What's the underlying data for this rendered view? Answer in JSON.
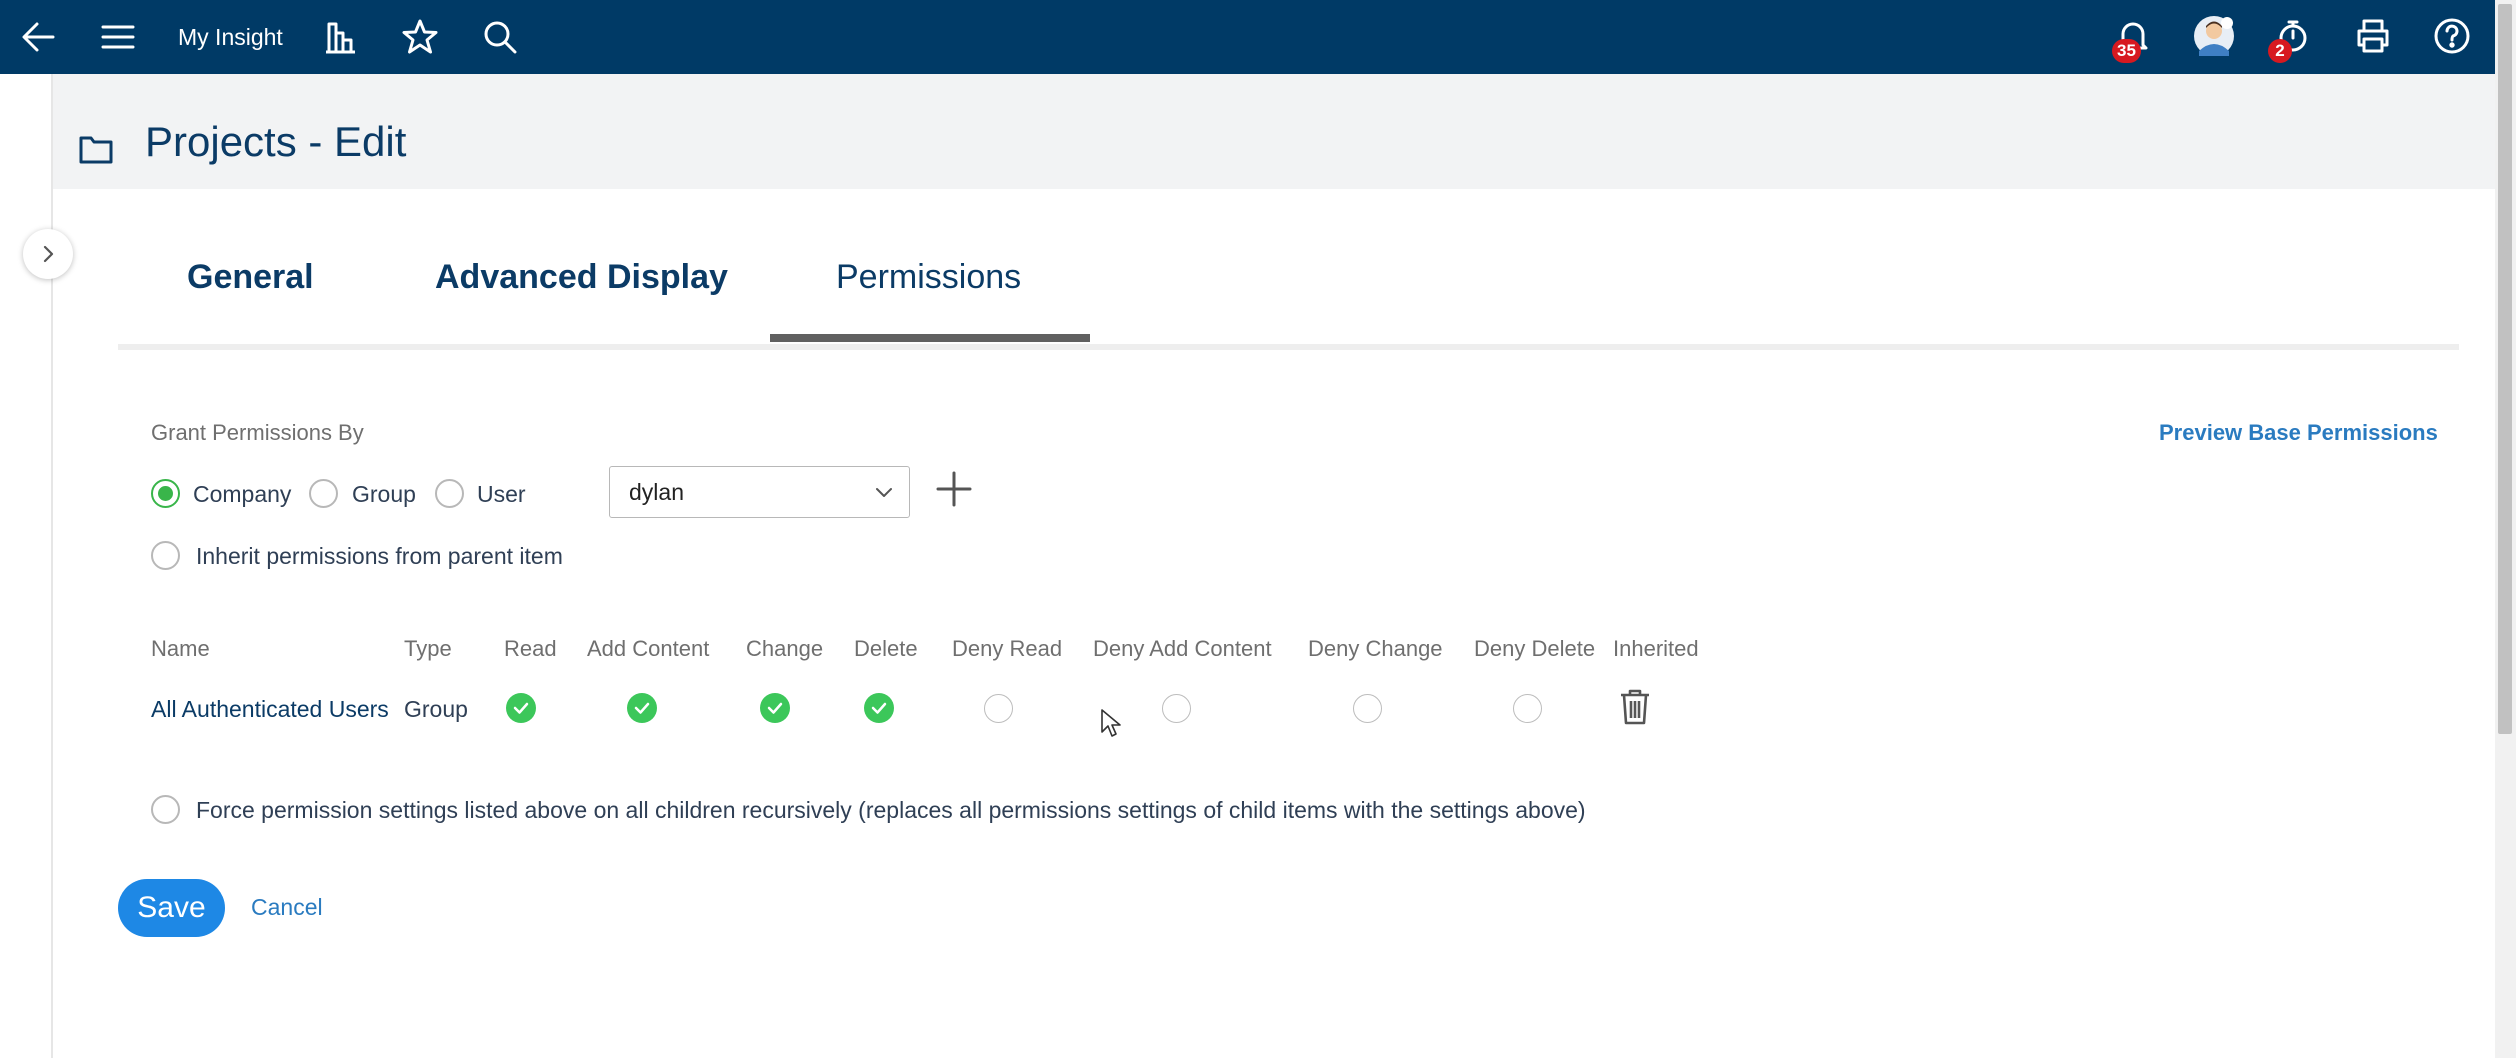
{
  "topbar": {
    "app_title": "My Insight",
    "notifications_count": "35",
    "timers_count": "2",
    "icons": [
      "back-arrow-icon",
      "menu-icon",
      "bar-chart-icon",
      "star-icon",
      "search-icon",
      "bell-icon",
      "user-avatar",
      "stopwatch-icon",
      "printer-icon",
      "help-icon"
    ]
  },
  "page": {
    "title": "Projects - Edit"
  },
  "tabs": [
    {
      "label": "General",
      "active": false
    },
    {
      "label": "Advanced Display",
      "active": false
    },
    {
      "label": "Permissions",
      "active": true
    }
  ],
  "grant": {
    "label": "Grant Permissions By",
    "preview_link": "Preview Base Permissions",
    "options": [
      {
        "label": "Company",
        "selected": true
      },
      {
        "label": "Group",
        "selected": false
      },
      {
        "label": "User",
        "selected": false
      }
    ],
    "dropdown_value": "dylan",
    "inherit_label": "Inherit permissions from parent item"
  },
  "table": {
    "headers": [
      "Name",
      "Type",
      "Read",
      "Add Content",
      "Change",
      "Delete",
      "Deny Read",
      "Deny Add Content",
      "Deny Change",
      "Deny Delete",
      "Inherited"
    ],
    "rows": [
      {
        "name": "All Authenticated Users",
        "type": "Group",
        "read": true,
        "add_content": true,
        "change": true,
        "delete": true,
        "deny_read": false,
        "deny_add_content": false,
        "deny_change": false,
        "deny_delete": false
      }
    ]
  },
  "force": {
    "label": "Force permission settings listed above on all children recursively (replaces all permissions settings of child items with the settings above)"
  },
  "actions": {
    "save_label": "Save",
    "cancel_label": "Cancel"
  },
  "colors": {
    "topbar": "#003a66",
    "accent": "#1e88e5",
    "check": "#3cc75a",
    "badge": "#d71920"
  }
}
